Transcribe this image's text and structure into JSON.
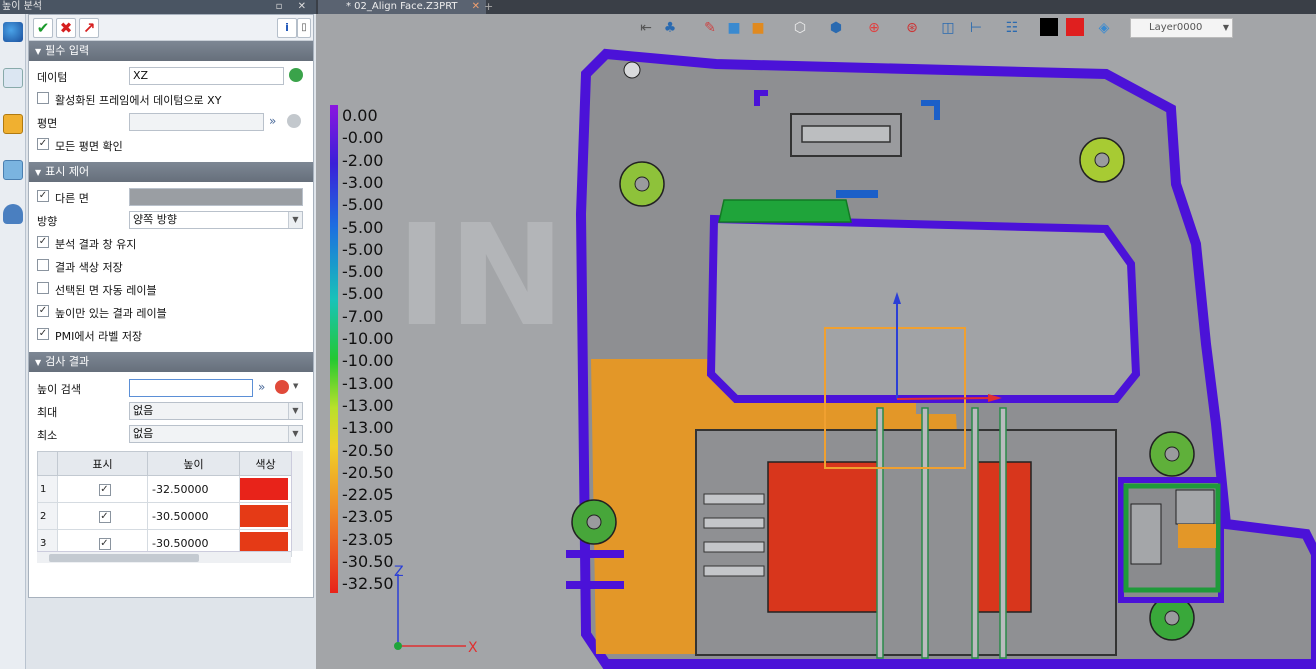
{
  "panel": {
    "title": "높이 분석",
    "sections": {
      "required": "필수 입력",
      "display": "표시 제어",
      "results": "검사 결과"
    },
    "required": {
      "datum_label": "데이텀",
      "datum_value": "XZ",
      "active_frame_label": "활성화된 프레임에서 데이텀으로 XY",
      "plane_label": "평면",
      "plane_value": "",
      "all_planes_label": "모든 평면 확인"
    },
    "display": {
      "other_face_label": "다른 면",
      "direction_label": "방향",
      "direction_value": "양쪽 방향",
      "keep_window_label": "분석 결과 창 유지",
      "save_color_label": "결과 색상 저장",
      "auto_label_label": "선택된 면 자동 레이블",
      "height_label_label": "높이만 있는 결과 레이블",
      "pmi_label": "PMI에서 라벨 저장"
    },
    "results": {
      "search_label": "높이 검색",
      "search_value": "",
      "max_label": "최대",
      "max_value": "없음",
      "min_label": "최소",
      "min_value": "없음",
      "columns": [
        "표시",
        "높이",
        "색상"
      ],
      "rows": [
        {
          "index": "1",
          "height": "-32.50000",
          "color": "#e8231a"
        },
        {
          "index": "2",
          "height": "-30.50000",
          "color": "#e53a16"
        },
        {
          "index": "3",
          "height": "-30.50000",
          "color": "#e53a16"
        }
      ]
    }
  },
  "tab": {
    "title": "* 02_Align Face.Z3PRT"
  },
  "viewport": {
    "layer": "Layer0000",
    "legend_values": [
      "0.00",
      "-0.00",
      "-2.00",
      "-3.00",
      "-5.00",
      "-5.00",
      "-5.00",
      "-5.00",
      "-5.00",
      "-7.00",
      "-10.00",
      "-10.00",
      "-13.00",
      "-13.00",
      "-13.00",
      "-20.50",
      "-20.50",
      "-22.05",
      "-23.05",
      "-23.05",
      "-30.50",
      "-32.50"
    ],
    "axis_z": "Z",
    "axis_x": "X",
    "watermark": "INNTRA SOLUTION"
  }
}
